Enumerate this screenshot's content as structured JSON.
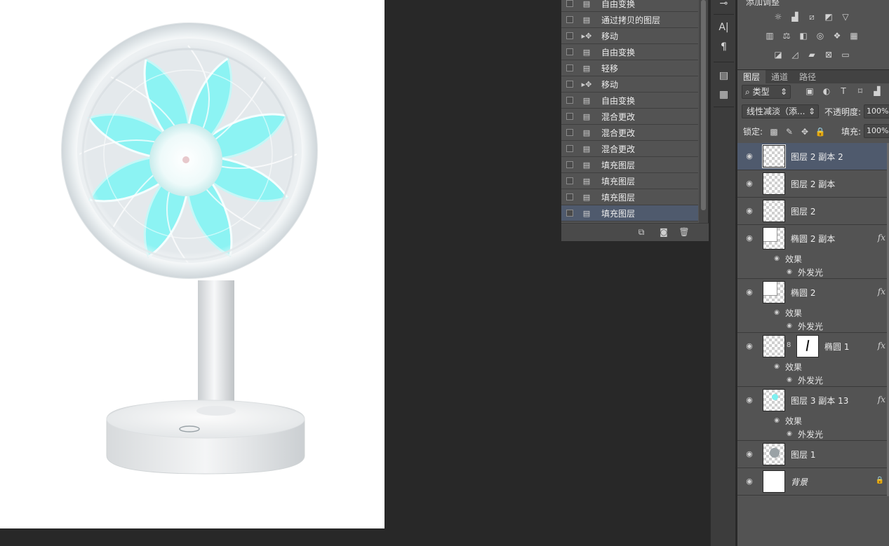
{
  "history": {
    "items": [
      {
        "label": "自由变换",
        "icon": "document-icon",
        "selected": false
      },
      {
        "label": "通过拷贝的图层",
        "icon": "document-icon",
        "selected": false
      },
      {
        "label": "移动",
        "icon": "move-tool-icon",
        "selected": false
      },
      {
        "label": "自由变换",
        "icon": "document-icon",
        "selected": false
      },
      {
        "label": "轻移",
        "icon": "document-icon",
        "selected": false
      },
      {
        "label": "移动",
        "icon": "move-tool-icon",
        "selected": false
      },
      {
        "label": "自由变换",
        "icon": "document-icon",
        "selected": false
      },
      {
        "label": "混合更改",
        "icon": "document-icon",
        "selected": false
      },
      {
        "label": "混合更改",
        "icon": "document-icon",
        "selected": false
      },
      {
        "label": "混合更改",
        "icon": "document-icon",
        "selected": false
      },
      {
        "label": "填充图层",
        "icon": "document-icon",
        "selected": false
      },
      {
        "label": "填充图层",
        "icon": "document-icon",
        "selected": false
      },
      {
        "label": "填充图层",
        "icon": "document-icon",
        "selected": false
      },
      {
        "label": "填充图层",
        "icon": "document-icon",
        "selected": true
      }
    ]
  },
  "adjustments": {
    "title": "添加调整"
  },
  "layers_panel": {
    "tabs": [
      "图层",
      "通道",
      "路径"
    ],
    "active_tab": "图层",
    "filter_kind": "类型",
    "blend_mode": "线性减淡（添...",
    "opacity_label": "不透明度:",
    "opacity_value": "100%",
    "lock_label": "锁定:",
    "fill_label": "填充:",
    "fill_value": "100%",
    "effects_label": "效果",
    "outer_glow_label": "外发光",
    "layers": [
      {
        "name": "图层 2 副本 2",
        "selected": true,
        "fx": false,
        "effects": false,
        "thumb": "transparent"
      },
      {
        "name": "图层 2 副本",
        "selected": false,
        "fx": false,
        "effects": false,
        "thumb": "transparent"
      },
      {
        "name": "图层 2",
        "selected": false,
        "fx": false,
        "effects": false,
        "thumb": "transparent"
      },
      {
        "name": "椭圆 2 副本",
        "selected": false,
        "fx": true,
        "effects": true,
        "thumb": "shape"
      },
      {
        "name": "椭圆 2",
        "selected": false,
        "fx": true,
        "effects": true,
        "thumb": "shape"
      },
      {
        "name": "椭圆 1",
        "selected": false,
        "fx": true,
        "effects": true,
        "thumb": "masked"
      },
      {
        "name": "图层 3 副本 13",
        "selected": false,
        "fx": true,
        "effects": true,
        "thumb": "cyan"
      },
      {
        "name": "图层 1",
        "selected": false,
        "fx": false,
        "effects": false,
        "thumb": "fan"
      },
      {
        "name": "背景",
        "selected": false,
        "fx": false,
        "effects": false,
        "thumb": "white",
        "locked": true
      }
    ]
  },
  "colors": {
    "fan_blade": "#7ef0f0",
    "selection": "#4f5a6d",
    "panel_bg": "#535353"
  }
}
